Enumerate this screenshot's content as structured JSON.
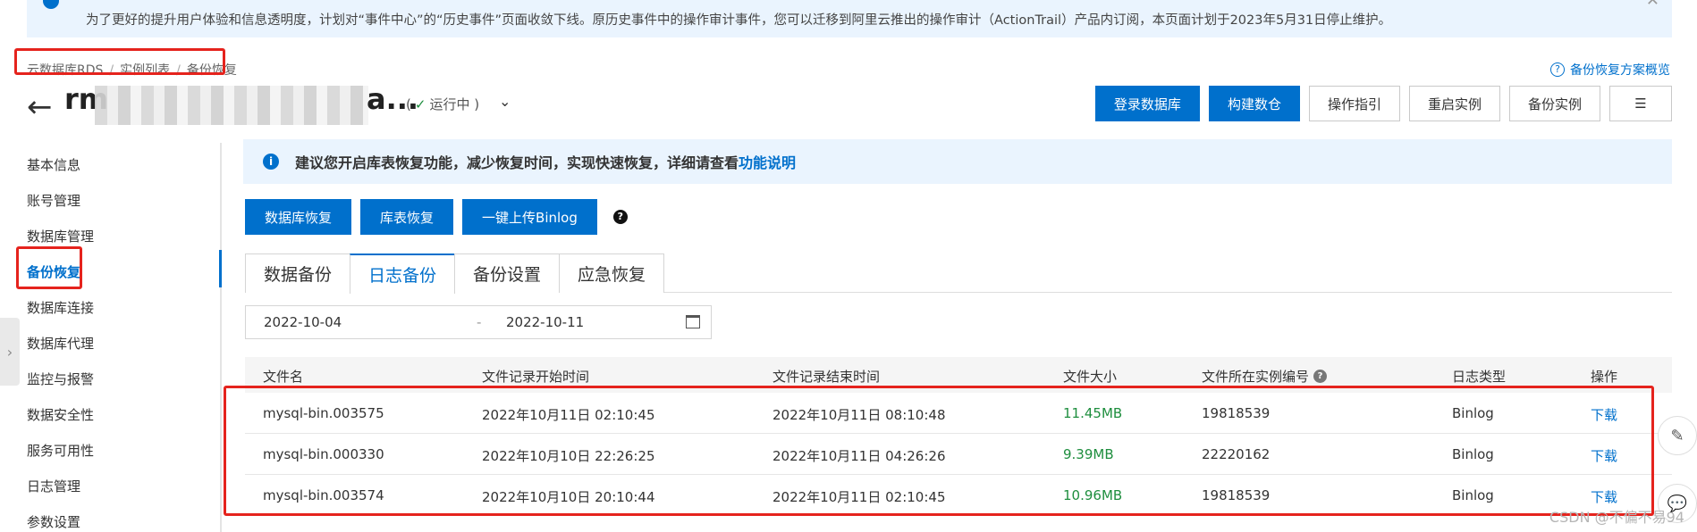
{
  "notice": {
    "text": "为了更好的提升用户体验和信息透明度，计划对“事件中心”的“历史事件”页面收敛下线。原历史事件中的操作审计事件，您可以迁移到阿里云推出的操作审计（ActionTrail）产品内订阅，本页面计划于2023年5月31日停止维护。",
    "close_icon": "close-icon"
  },
  "breadcrumb": [
    "云数据库RDS",
    "实例列表",
    "备份恢复"
  ],
  "help_link": "备份恢复方案概览",
  "instance": {
    "title_prefix": "rm",
    "title_suffix": "a...",
    "status_open": "(",
    "status": "运行中",
    "status_close": ")"
  },
  "top_actions": {
    "login_db": "登录数据库",
    "build_warehouse": "构建数仓",
    "guide": "操作指引",
    "restart": "重启实例",
    "backup": "备份实例"
  },
  "sidebar": {
    "items": [
      "基本信息",
      "账号管理",
      "数据库管理",
      "备份恢复",
      "数据库连接",
      "数据库代理",
      "监控与报警",
      "数据安全性",
      "服务可用性",
      "日志管理",
      "参数设置"
    ],
    "active_index": 3
  },
  "tip": {
    "message": "建议您开启库表恢复功能，减少恢复时间，实现快速恢复，详细请查看",
    "link": "功能说明"
  },
  "op_buttons": {
    "db_restore": "数据库恢复",
    "table_restore": "库表恢复",
    "upload_binlog": "一键上传Binlog"
  },
  "tabs": [
    "数据备份",
    "日志备份",
    "备份设置",
    "应急恢复"
  ],
  "active_tab": 1,
  "date_range": {
    "start": "2022-10-04",
    "separator": "-",
    "end": "2022-10-11"
  },
  "table": {
    "columns": [
      "文件名",
      "文件记录开始时间",
      "文件记录结束时间",
      "文件大小",
      "文件所在实例编号",
      "日志类型",
      "操作"
    ],
    "rows": [
      {
        "file": "mysql-bin.003575",
        "start": "2022年10月11日 02:10:45",
        "end": "2022年10月11日 08:10:48",
        "size": "11.45MB",
        "instance_id": "19818539",
        "type": "Binlog",
        "action": "下载"
      },
      {
        "file": "mysql-bin.000330",
        "start": "2022年10月10日 22:26:25",
        "end": "2022年10月11日 04:26:26",
        "size": "9.39MB",
        "instance_id": "22220162",
        "type": "Binlog",
        "action": "下载"
      },
      {
        "file": "mysql-bin.003574",
        "start": "2022年10月10日 20:10:44",
        "end": "2022年10月11日 02:10:45",
        "size": "10.96MB",
        "instance_id": "19818539",
        "type": "Binlog",
        "action": "下载"
      }
    ]
  },
  "watermark": "CSDN @不偏不易94"
}
